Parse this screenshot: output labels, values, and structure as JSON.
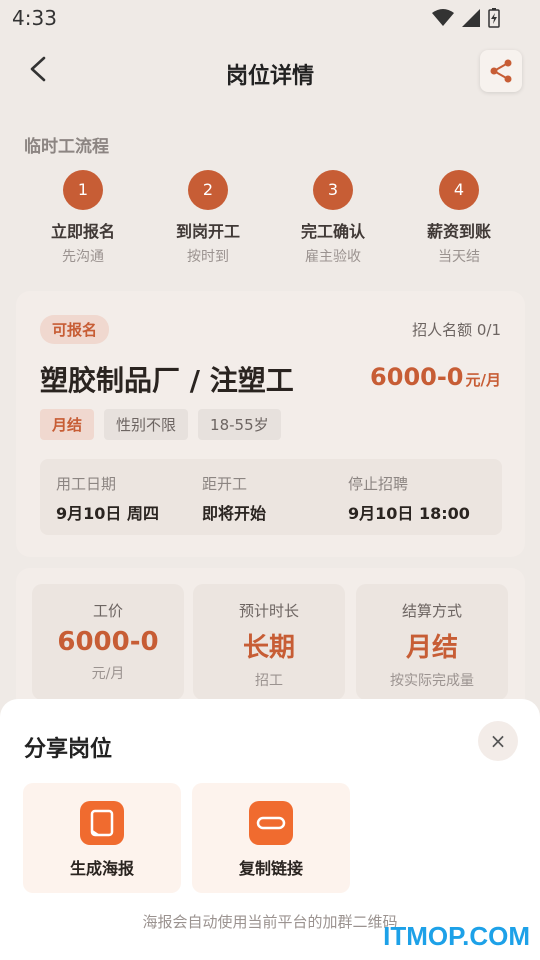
{
  "status_bar": {
    "time": "4:33"
  },
  "header": {
    "title": "岗位详情"
  },
  "flow": {
    "title": "临时工流程",
    "steps": [
      {
        "number": "1",
        "label": "立即报名",
        "sub": "先沟通"
      },
      {
        "number": "2",
        "label": "到岗开工",
        "sub": "按时到"
      },
      {
        "number": "3",
        "label": "完工确认",
        "sub": "雇主验收"
      },
      {
        "number": "4",
        "label": "薪资到账",
        "sub": "当天结"
      }
    ]
  },
  "job": {
    "status": "可报名",
    "quota": "招人名额 0/1",
    "title": "塑胶制品厂 / 注塑工",
    "salary": "6000-0",
    "salary_unit": "元/月",
    "tags": [
      "月结",
      "性别不限",
      "18-55岁"
    ],
    "meta": [
      {
        "label": "用工日期",
        "value": "9月10日 周四"
      },
      {
        "label": "距开工",
        "value": "即将开始"
      },
      {
        "label": "停止招聘",
        "value": "9月10日 18:00"
      }
    ]
  },
  "pay": [
    {
      "label": "工价",
      "value": "6000-0",
      "sub": "元/月"
    },
    {
      "label": "预计时长",
      "value": "长期",
      "sub": "招工"
    },
    {
      "label": "结算方式",
      "value": "月结",
      "sub": "按实际完成量"
    }
  ],
  "share_sheet": {
    "title": "分享岗位",
    "close": "×",
    "actions": [
      {
        "label": "生成海报",
        "icon": "poster-icon"
      },
      {
        "label": "复制链接",
        "icon": "link-icon"
      }
    ],
    "note": "海报会自动使用当前平台的加群二维码"
  },
  "watermark": "ITMOP.COM",
  "colors": {
    "accent": "#c75d35",
    "action_orange": "#f06b2f",
    "watermark": "#1da1e8"
  }
}
